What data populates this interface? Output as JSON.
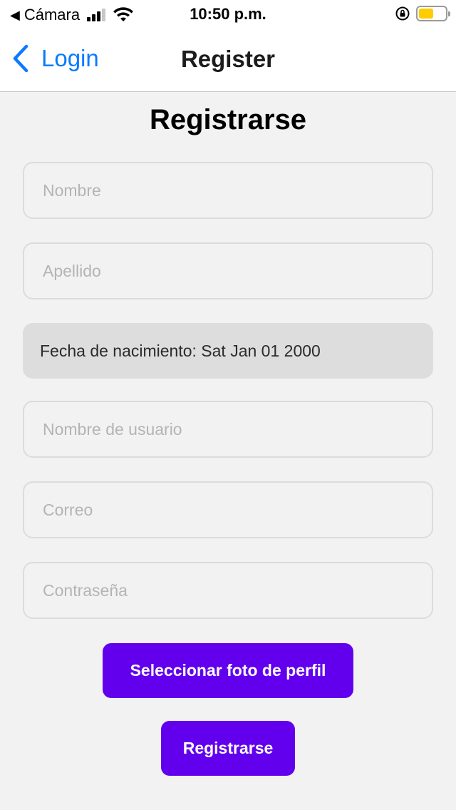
{
  "status_bar": {
    "back_label": "Cámara",
    "time": "10:50 p.m.",
    "battery_level": 0.55,
    "battery_color": "#ffcc00",
    "icons": [
      "back-triangle-icon",
      "signal-icon",
      "wifi-icon",
      "orientation-lock-icon",
      "battery-icon"
    ]
  },
  "nav": {
    "back_label": "Login",
    "title": "Register",
    "accent": "#0a7aff"
  },
  "form": {
    "title": "Registrarse",
    "first_name": {
      "placeholder": "Nombre",
      "value": ""
    },
    "last_name": {
      "placeholder": "Apellido",
      "value": ""
    },
    "birth_date_text": "Fecha de nacimiento: Sat Jan 01 2000",
    "username": {
      "placeholder": "Nombre de usuario",
      "value": ""
    },
    "email": {
      "placeholder": "Correo",
      "value": ""
    },
    "password": {
      "placeholder": "Contraseña",
      "value": ""
    },
    "select_photo_label": "Seleccionar foto de perfil",
    "submit_label": "Registrarse",
    "button_color": "#6200ee"
  }
}
